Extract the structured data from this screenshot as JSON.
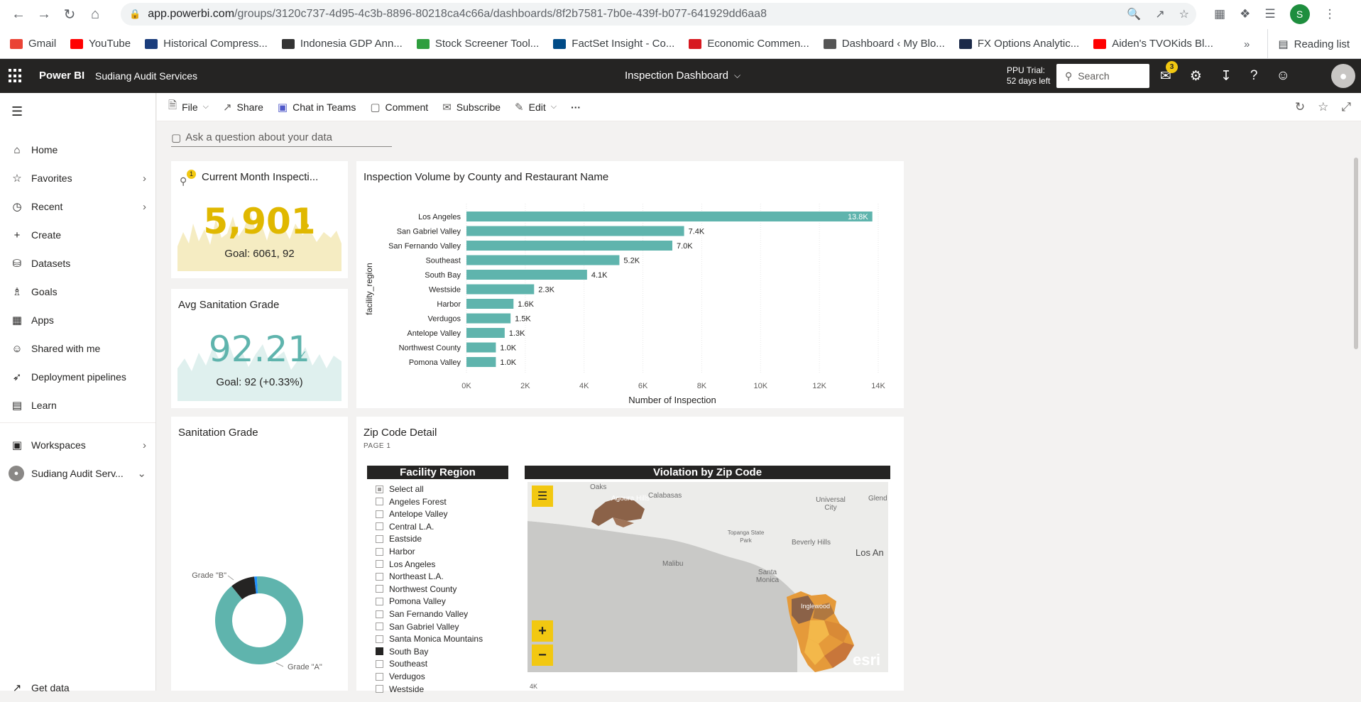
{
  "browser": {
    "url_host": "app.powerbi.com",
    "url_path": "/groups/3120c737-4d95-4c3b-8896-80218ca4c66a/dashboards/8f2b7581-7b0e-439f-b077-641929dd6aa8",
    "profile_initial": "S",
    "bookmarks": [
      {
        "label": "Gmail",
        "color": "#ea4335"
      },
      {
        "label": "YouTube",
        "color": "#ff0000"
      },
      {
        "label": "Historical Compress...",
        "color": "#1a3d7c"
      },
      {
        "label": "Indonesia GDP Ann...",
        "color": "#333333"
      },
      {
        "label": "Stock Screener Tool...",
        "color": "#2e9e3e"
      },
      {
        "label": "FactSet Insight - Co...",
        "color": "#004b87"
      },
      {
        "label": "Economic Commen...",
        "color": "#d71920"
      },
      {
        "label": "Dashboard ‹ My Blo...",
        "color": "#555555"
      },
      {
        "label": "FX Options Analytic...",
        "color": "#1b2a49"
      },
      {
        "label": "Aiden's TVOKids Bl...",
        "color": "#ff0000"
      }
    ],
    "bookmarks_more": "»",
    "reading_list": "Reading list"
  },
  "pbi": {
    "brand": "Power BI",
    "workspace": "Sudiang Audit Services",
    "dashboard_title": "Inspection Dashboard",
    "ppu_line1": "PPU Trial:",
    "ppu_line2": "52 days left",
    "search_placeholder": "Search",
    "notification_count": "3"
  },
  "sidenav": {
    "items": [
      {
        "label": "Home",
        "icon": "home-icon"
      },
      {
        "label": "Favorites",
        "icon": "star-icon",
        "chevron": true
      },
      {
        "label": "Recent",
        "icon": "clock-icon",
        "chevron": true
      },
      {
        "label": "Create",
        "icon": "plus-icon"
      },
      {
        "label": "Datasets",
        "icon": "database-icon"
      },
      {
        "label": "Goals",
        "icon": "trophy-icon"
      },
      {
        "label": "Apps",
        "icon": "apps-icon"
      },
      {
        "label": "Shared with me",
        "icon": "shared-icon"
      },
      {
        "label": "Deployment pipelines",
        "icon": "rocket-icon"
      },
      {
        "label": "Learn",
        "icon": "book-icon"
      },
      {
        "label": "Workspaces",
        "icon": "workspaces-icon",
        "chevron": true
      },
      {
        "label": "Sudiang Audit Serv...",
        "icon": "workspace-avatar-icon",
        "chevron": true
      }
    ],
    "get_data": "Get data"
  },
  "actionbar": {
    "file": "File",
    "share": "Share",
    "chat": "Chat in Teams",
    "comment": "Comment",
    "subscribe": "Subscribe",
    "edit": "Edit",
    "more": "···"
  },
  "qa_placeholder": "Ask a question about your data",
  "tiles": {
    "current_month": {
      "title": "Current Month Inspecti...",
      "value": "5,901",
      "goal": "Goal: 6061, 92",
      "alert_badge": "1",
      "color": "#e0b800"
    },
    "avg_grade": {
      "title": "Avg Sanitation Grade",
      "value": "92.21",
      "goal": "Goal: 92 (+0.33%)",
      "check": "✓",
      "color": "#5fb4ad"
    },
    "sanitation_grade": {
      "title": "Sanitation Grade",
      "chart_data": {
        "type": "pie",
        "categories": [
          "Grade \"A\"",
          "Grade \"B\"",
          ""
        ],
        "values": [
          90,
          9,
          1
        ],
        "colors": [
          "#5fb4ad",
          "#252423",
          "#1e90ff"
        ],
        "donut": true
      },
      "label_a": "Grade \"A\"",
      "label_b": "Grade \"B\""
    },
    "inspection_volume": {
      "title": "Inspection Volume by County and Restaurant Name",
      "chart_data": {
        "type": "bar",
        "orientation": "horizontal",
        "categories": [
          "Los Angeles",
          "San Gabriel Valley",
          "San Fernando Valley",
          "Southeast",
          "South Bay",
          "Westside",
          "Harbor",
          "Verdugos",
          "Antelope Valley",
          "Northwest County",
          "Pomona Valley"
        ],
        "values": [
          13800,
          7400,
          7000,
          5200,
          4100,
          2300,
          1600,
          1500,
          1300,
          1000,
          1000
        ],
        "value_labels": [
          "13.8K",
          "7.4K",
          "7.0K",
          "5.2K",
          "4.1K",
          "2.3K",
          "1.6K",
          "1.5K",
          "1.3K",
          "1.0K",
          "1.0K"
        ],
        "xlim": [
          0,
          14000
        ],
        "xticks": [
          "0K",
          "2K",
          "4K",
          "6K",
          "8K",
          "10K",
          "12K",
          "14K"
        ],
        "xlabel": "Number of Inspection",
        "ylabel": "facility_region",
        "grid": true,
        "color": "#5fb4ad"
      }
    },
    "zip_detail": {
      "title": "Zip Code Detail",
      "subtitle": "PAGE 1",
      "slicer_title": "Facility Region",
      "slicer_items": [
        {
          "label": "Select all",
          "state": "partial"
        },
        {
          "label": "Angeles Forest",
          "state": "off"
        },
        {
          "label": "Antelope Valley",
          "state": "off"
        },
        {
          "label": "Central L.A.",
          "state": "off"
        },
        {
          "label": "Eastside",
          "state": "off"
        },
        {
          "label": "Harbor",
          "state": "off"
        },
        {
          "label": "Los Angeles",
          "state": "off"
        },
        {
          "label": "Northeast L.A.",
          "state": "off"
        },
        {
          "label": "Northwest County",
          "state": "off"
        },
        {
          "label": "Pomona Valley",
          "state": "off"
        },
        {
          "label": "San Fernando Valley",
          "state": "off"
        },
        {
          "label": "San Gabriel Valley",
          "state": "off"
        },
        {
          "label": "Santa Monica Mountains",
          "state": "off"
        },
        {
          "label": "South Bay",
          "state": "checked"
        },
        {
          "label": "Southeast",
          "state": "off"
        },
        {
          "label": "Verdugos",
          "state": "off"
        },
        {
          "label": "Westside",
          "state": "off"
        }
      ],
      "map_title": "Violation by Zip Code",
      "map_labels": [
        "Oaks",
        "Agoura Hills",
        "Calabasas",
        "Universal City",
        "Glend",
        "Topanga State Park",
        "Beverly Hills",
        "Los An",
        "Malibu",
        "Santa Monica",
        "Inglewood",
        "esri"
      ],
      "map_axis_tick": "4K"
    }
  }
}
